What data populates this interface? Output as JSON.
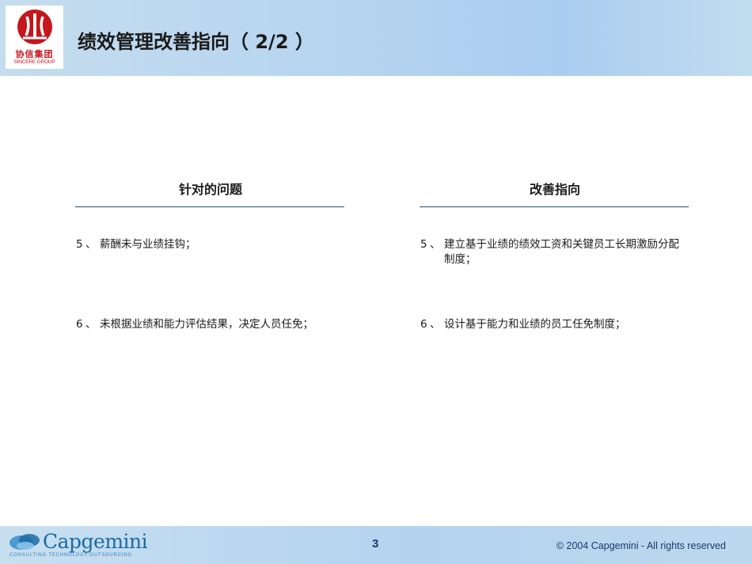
{
  "header": {
    "logo": {
      "name_cn": "协信集团",
      "name_en": "SINCERE GROUP",
      "icon": "sincere-group-emblem"
    },
    "title": "绩效管理改善指向（ 2/2 ）"
  },
  "columns": [
    {
      "heading": "针对的问题",
      "items": [
        {
          "num": "5",
          "sep": "、",
          "text": "薪酬未与业绩挂钩；"
        },
        {
          "num": "6",
          "sep": "、",
          "text": "未根据业绩和能力评估结果，决定人员任免；"
        }
      ]
    },
    {
      "heading": "改善指向",
      "items": [
        {
          "num": "5",
          "sep": "、",
          "text": "建立基于业绩的绩效工资和关键员工长期激励分配制度；"
        },
        {
          "num": "6",
          "sep": "、",
          "text": "设计基于能力和业绩的员工任免制度；"
        }
      ]
    }
  ],
  "footer": {
    "logo_word": "Capgemini",
    "logo_tagline": "CONSULTING.TECHNOLOGY.OUTSOURCING",
    "page_number": "3",
    "copyright": "© 2004 Capgemini - All rights reserved"
  },
  "colors": {
    "header_blue": "#b8d6f0",
    "rule": "#24506e",
    "logo_red": "#c4161c",
    "capgemini_blue": "#1b6aa5"
  }
}
